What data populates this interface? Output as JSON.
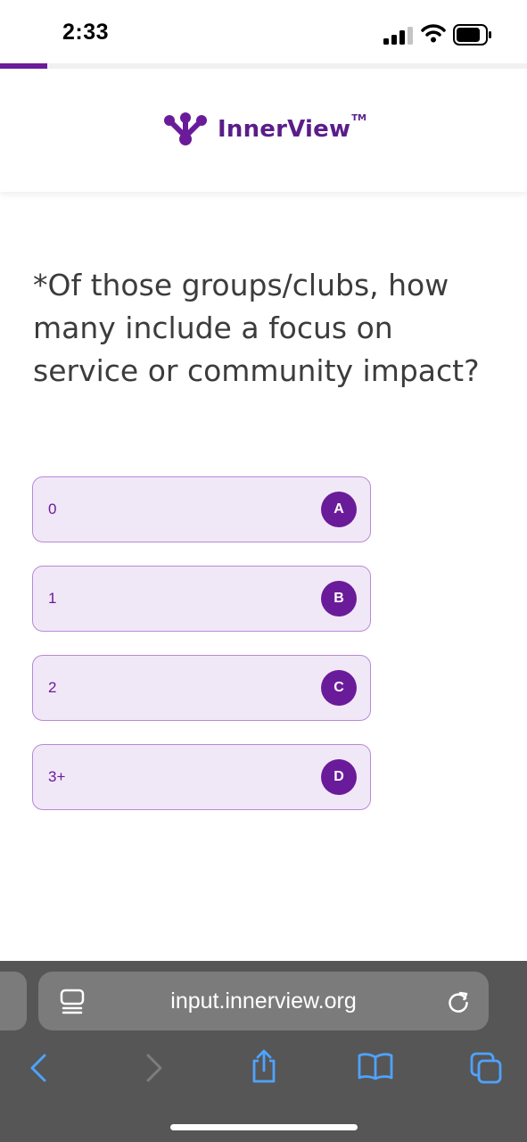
{
  "status_bar": {
    "time": "2:33"
  },
  "progress": {
    "fraction": 0.09
  },
  "header": {
    "logo_text": "InnerView",
    "logo_trademark": "TM"
  },
  "question": {
    "text": "*Of those groups/clubs, how many include a focus on service or community impact?"
  },
  "options": [
    {
      "label": "0",
      "key": "A"
    },
    {
      "label": "1",
      "key": "B"
    },
    {
      "label": "2",
      "key": "C"
    },
    {
      "label": "3+",
      "key": "D"
    }
  ],
  "browser": {
    "url": "input.innerview.org",
    "icons": [
      "reader-mode-icon",
      "reload-icon",
      "back-icon",
      "forward-icon",
      "share-icon",
      "bookmarks-icon",
      "tabs-icon"
    ]
  },
  "colors": {
    "accent": "#6a1b9a",
    "option_bg": "#f1e8f7",
    "option_border": "#b88ad6",
    "browser_bar": "#565656"
  }
}
